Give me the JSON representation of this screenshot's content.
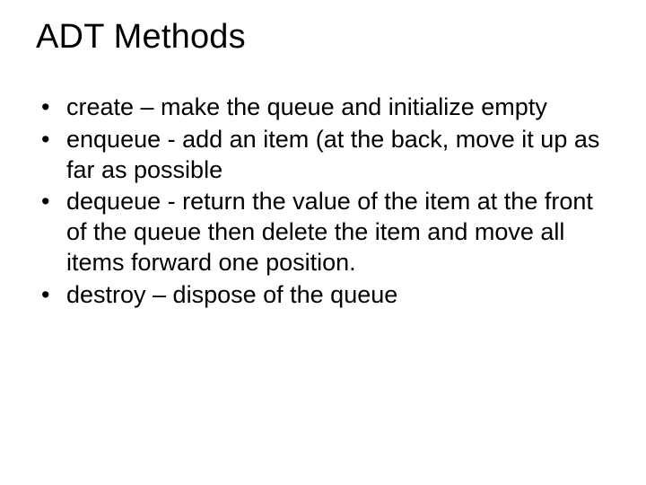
{
  "slide": {
    "title": "ADT Methods",
    "bullets": [
      "create – make the queue and initialize empty",
      "enqueue - add an item (at the back, move it up as far as possible",
      "dequeue - return the value of the item at the front of the queue then delete the item and move all items forward one position.",
      "destroy – dispose of the queue"
    ]
  }
}
